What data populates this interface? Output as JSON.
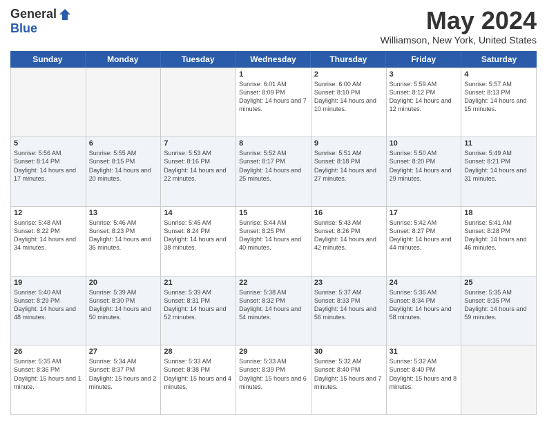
{
  "logo": {
    "general": "General",
    "blue": "Blue"
  },
  "header": {
    "month": "May 2024",
    "location": "Williamson, New York, United States"
  },
  "weekdays": [
    "Sunday",
    "Monday",
    "Tuesday",
    "Wednesday",
    "Thursday",
    "Friday",
    "Saturday"
  ],
  "weeks": [
    [
      {
        "day": "",
        "empty": true
      },
      {
        "day": "",
        "empty": true
      },
      {
        "day": "",
        "empty": true
      },
      {
        "day": "1",
        "sunrise": "Sunrise: 6:01 AM",
        "sunset": "Sunset: 8:09 PM",
        "daylight": "Daylight: 14 hours and 7 minutes."
      },
      {
        "day": "2",
        "sunrise": "Sunrise: 6:00 AM",
        "sunset": "Sunset: 8:10 PM",
        "daylight": "Daylight: 14 hours and 10 minutes."
      },
      {
        "day": "3",
        "sunrise": "Sunrise: 5:59 AM",
        "sunset": "Sunset: 8:12 PM",
        "daylight": "Daylight: 14 hours and 12 minutes."
      },
      {
        "day": "4",
        "sunrise": "Sunrise: 5:57 AM",
        "sunset": "Sunset: 8:13 PM",
        "daylight": "Daylight: 14 hours and 15 minutes."
      }
    ],
    [
      {
        "day": "5",
        "sunrise": "Sunrise: 5:56 AM",
        "sunset": "Sunset: 8:14 PM",
        "daylight": "Daylight: 14 hours and 17 minutes."
      },
      {
        "day": "6",
        "sunrise": "Sunrise: 5:55 AM",
        "sunset": "Sunset: 8:15 PM",
        "daylight": "Daylight: 14 hours and 20 minutes."
      },
      {
        "day": "7",
        "sunrise": "Sunrise: 5:53 AM",
        "sunset": "Sunset: 8:16 PM",
        "daylight": "Daylight: 14 hours and 22 minutes."
      },
      {
        "day": "8",
        "sunrise": "Sunrise: 5:52 AM",
        "sunset": "Sunset: 8:17 PM",
        "daylight": "Daylight: 14 hours and 25 minutes."
      },
      {
        "day": "9",
        "sunrise": "Sunrise: 5:51 AM",
        "sunset": "Sunset: 8:18 PM",
        "daylight": "Daylight: 14 hours and 27 minutes."
      },
      {
        "day": "10",
        "sunrise": "Sunrise: 5:50 AM",
        "sunset": "Sunset: 8:20 PM",
        "daylight": "Daylight: 14 hours and 29 minutes."
      },
      {
        "day": "11",
        "sunrise": "Sunrise: 5:49 AM",
        "sunset": "Sunset: 8:21 PM",
        "daylight": "Daylight: 14 hours and 31 minutes."
      }
    ],
    [
      {
        "day": "12",
        "sunrise": "Sunrise: 5:48 AM",
        "sunset": "Sunset: 8:22 PM",
        "daylight": "Daylight: 14 hours and 34 minutes."
      },
      {
        "day": "13",
        "sunrise": "Sunrise: 5:46 AM",
        "sunset": "Sunset: 8:23 PM",
        "daylight": "Daylight: 14 hours and 36 minutes."
      },
      {
        "day": "14",
        "sunrise": "Sunrise: 5:45 AM",
        "sunset": "Sunset: 8:24 PM",
        "daylight": "Daylight: 14 hours and 38 minutes."
      },
      {
        "day": "15",
        "sunrise": "Sunrise: 5:44 AM",
        "sunset": "Sunset: 8:25 PM",
        "daylight": "Daylight: 14 hours and 40 minutes."
      },
      {
        "day": "16",
        "sunrise": "Sunrise: 5:43 AM",
        "sunset": "Sunset: 8:26 PM",
        "daylight": "Daylight: 14 hours and 42 minutes."
      },
      {
        "day": "17",
        "sunrise": "Sunrise: 5:42 AM",
        "sunset": "Sunset: 8:27 PM",
        "daylight": "Daylight: 14 hours and 44 minutes."
      },
      {
        "day": "18",
        "sunrise": "Sunrise: 5:41 AM",
        "sunset": "Sunset: 8:28 PM",
        "daylight": "Daylight: 14 hours and 46 minutes."
      }
    ],
    [
      {
        "day": "19",
        "sunrise": "Sunrise: 5:40 AM",
        "sunset": "Sunset: 8:29 PM",
        "daylight": "Daylight: 14 hours and 48 minutes."
      },
      {
        "day": "20",
        "sunrise": "Sunrise: 5:39 AM",
        "sunset": "Sunset: 8:30 PM",
        "daylight": "Daylight: 14 hours and 50 minutes."
      },
      {
        "day": "21",
        "sunrise": "Sunrise: 5:39 AM",
        "sunset": "Sunset: 8:31 PM",
        "daylight": "Daylight: 14 hours and 52 minutes."
      },
      {
        "day": "22",
        "sunrise": "Sunrise: 5:38 AM",
        "sunset": "Sunset: 8:32 PM",
        "daylight": "Daylight: 14 hours and 54 minutes."
      },
      {
        "day": "23",
        "sunrise": "Sunrise: 5:37 AM",
        "sunset": "Sunset: 8:33 PM",
        "daylight": "Daylight: 14 hours and 56 minutes."
      },
      {
        "day": "24",
        "sunrise": "Sunrise: 5:36 AM",
        "sunset": "Sunset: 8:34 PM",
        "daylight": "Daylight: 14 hours and 58 minutes."
      },
      {
        "day": "25",
        "sunrise": "Sunrise: 5:35 AM",
        "sunset": "Sunset: 8:35 PM",
        "daylight": "Daylight: 14 hours and 59 minutes."
      }
    ],
    [
      {
        "day": "26",
        "sunrise": "Sunrise: 5:35 AM",
        "sunset": "Sunset: 8:36 PM",
        "daylight": "Daylight: 15 hours and 1 minute."
      },
      {
        "day": "27",
        "sunrise": "Sunrise: 5:34 AM",
        "sunset": "Sunset: 8:37 PM",
        "daylight": "Daylight: 15 hours and 2 minutes."
      },
      {
        "day": "28",
        "sunrise": "Sunrise: 5:33 AM",
        "sunset": "Sunset: 8:38 PM",
        "daylight": "Daylight: 15 hours and 4 minutes."
      },
      {
        "day": "29",
        "sunrise": "Sunrise: 5:33 AM",
        "sunset": "Sunset: 8:39 PM",
        "daylight": "Daylight: 15 hours and 6 minutes."
      },
      {
        "day": "30",
        "sunrise": "Sunrise: 5:32 AM",
        "sunset": "Sunset: 8:40 PM",
        "daylight": "Daylight: 15 hours and 7 minutes."
      },
      {
        "day": "31",
        "sunrise": "Sunrise: 5:32 AM",
        "sunset": "Sunset: 8:40 PM",
        "daylight": "Daylight: 15 hours and 8 minutes."
      },
      {
        "day": "",
        "empty": true
      }
    ]
  ]
}
